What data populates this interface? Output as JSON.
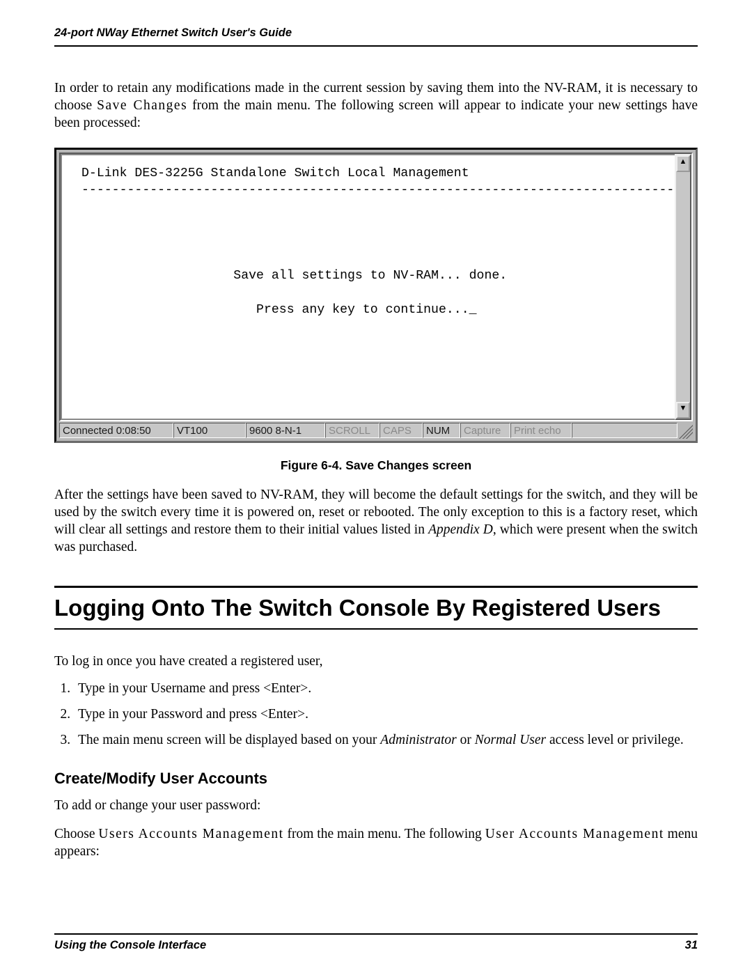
{
  "header": {
    "running_title": "24-port NWay Ethernet Switch User's Guide"
  },
  "para1": {
    "pre": "In order to retain any modifications made in the current session by saving them into the NV-RAM, it is necessary to choose ",
    "spaced": "Save Changes",
    "post": " from the main menu. The following screen will appear to indicate your new settings have been processed:"
  },
  "terminal": {
    "title_line": "D-Link DES-3225G Standalone Switch Local Management",
    "divider": "-------------------------------------------------------------------------------",
    "message1": "Save all settings to NV-RAM... done.",
    "message2": "Press any key to continue..._",
    "status": {
      "connected": "Connected 0:08:50",
      "terminal": "VT100",
      "port": "9600 8-N-1",
      "scroll": "SCROLL",
      "caps": "CAPS",
      "num": "NUM",
      "capture": "Capture",
      "echo": "Print echo"
    }
  },
  "figure_caption": "Figure 6-4.  Save Changes screen",
  "para2": {
    "pre": "After the settings have been saved to NV-RAM, they will become the default settings for the switch, and they will be used by the switch every time it is powered on, reset or rebooted. The only exception to this is a factory reset, which will clear all settings and restore them to their initial values listed in ",
    "italic": "Appendix D",
    "post": ", which were present when the switch was purchased."
  },
  "section_heading": "Logging Onto The Switch Console By Registered Users",
  "para3": "To log in once you have created a registered user,",
  "steps": {
    "s1": "Type in your Username and press <Enter>.",
    "s2": "Type in your Password and press <Enter>.",
    "s3_pre": "The main menu screen will be displayed based on your ",
    "s3_i1": "Administrator",
    "s3_mid": " or ",
    "s3_i2": "Normal User",
    "s3_post": " access level or privilege."
  },
  "subheading": "Create/Modify User Accounts",
  "para4": "To add or change your user password:",
  "para5": {
    "pre": "Choose ",
    "spaced1": "Users Accounts Management",
    "mid": " from the main menu. The following ",
    "spaced2": "User Accounts Management",
    "post": " menu appears:"
  },
  "footer": {
    "left": "Using the Console Interface",
    "right": "31"
  }
}
